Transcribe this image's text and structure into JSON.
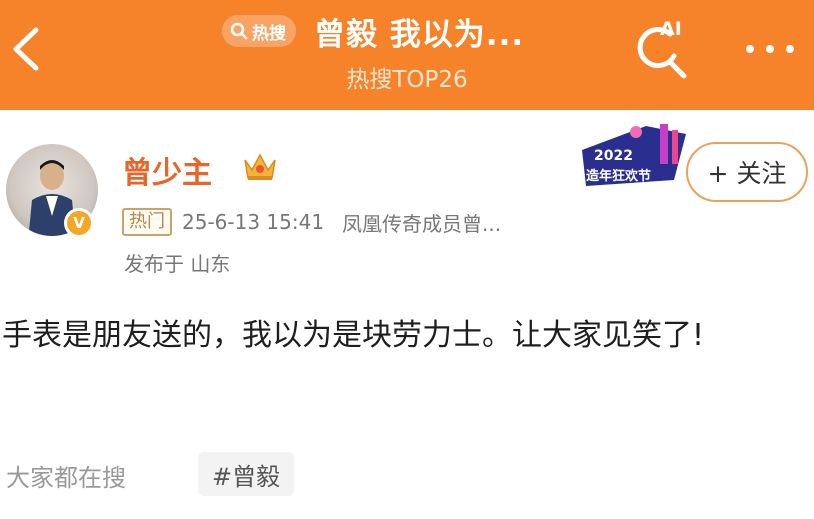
{
  "header": {
    "back_icon": "chevron-left-icon",
    "hot_search_pill_label": "热搜",
    "title": "曾毅 我以为...",
    "subtitle": "热搜TOP26",
    "ai_label": "AI",
    "more_icon": "more-dots-icon",
    "background_color": "#f6822a"
  },
  "post": {
    "username": "曾少主",
    "username_color": "#e9662b",
    "crown_icon": "crown-icon",
    "verified_badge": "V",
    "hot_tag": "热门",
    "time": "25-6-13 15:41",
    "source": "凤凰传奇成员曾...",
    "location": "发布于 山东",
    "event_badge_year": "2022",
    "event_badge_text": "造年狂欢节",
    "follow_label": "+ 关注",
    "content": "手表是朋友送的，我以为是块劳力士。让大家见笑了!"
  },
  "footer": {
    "everyone_search_label": "大家都在搜",
    "topic": "#曾毅"
  }
}
